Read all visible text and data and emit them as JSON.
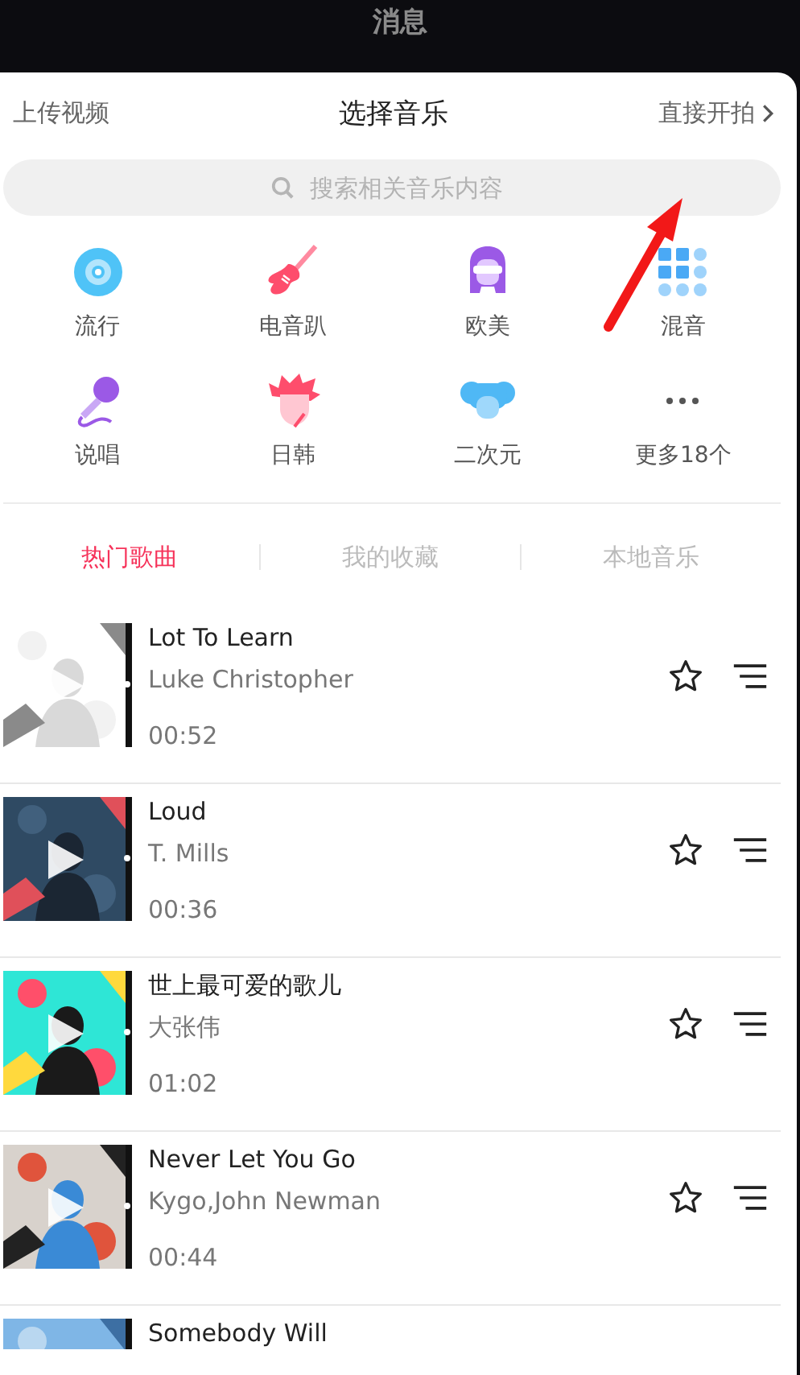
{
  "status_title": "消息",
  "header": {
    "left": "上传视频",
    "title": "选择音乐",
    "right": "直接开拍"
  },
  "search": {
    "placeholder": "搜索相关音乐内容"
  },
  "categories": [
    {
      "label": "流行",
      "kind": "disc"
    },
    {
      "label": "电音趴",
      "kind": "guitar"
    },
    {
      "label": "欧美",
      "kind": "rocker"
    },
    {
      "label": "混音",
      "kind": "grid"
    },
    {
      "label": "说唱",
      "kind": "mic"
    },
    {
      "label": "日韩",
      "kind": "spiky"
    },
    {
      "label": "二次元",
      "kind": "cartoon"
    },
    {
      "label": "更多18个",
      "kind": "more"
    }
  ],
  "tabs": [
    {
      "label": "热门歌曲",
      "selected": true
    },
    {
      "label": "我的收藏",
      "selected": false
    },
    {
      "label": "本地音乐",
      "selected": false
    }
  ],
  "songs": [
    {
      "title": "Lot To Learn",
      "artist": "Luke Christopher",
      "duration": "00:52"
    },
    {
      "title": "Loud",
      "artist": "T. Mills",
      "duration": "00:36"
    },
    {
      "title": "世上最可爱的歌儿",
      "artist": "大张伟",
      "duration": "01:02"
    },
    {
      "title": "Never Let You Go",
      "artist": "Kygo,John Newman",
      "duration": "00:44"
    },
    {
      "title": "Somebody Will"
    }
  ]
}
